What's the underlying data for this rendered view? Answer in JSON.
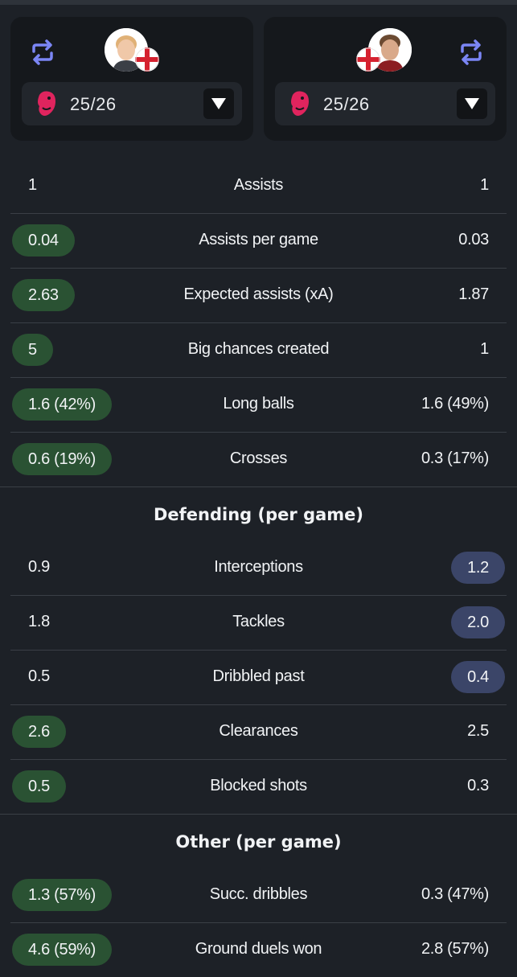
{
  "players": [
    {
      "season": "25/26",
      "competition_icon": "premier-league-icon",
      "swap_icon": "swap-icon",
      "flag_icon": "england-flag-icon"
    },
    {
      "season": "25/26",
      "competition_icon": "premier-league-icon",
      "swap_icon": "swap-icon",
      "flag_icon": "england-flag-icon"
    }
  ],
  "colors": {
    "left_highlight": "#2a5233",
    "right_highlight": "#3b4568",
    "background": "#1d2127",
    "card": "#15181c"
  },
  "sections": [
    {
      "title": "",
      "rows": [
        {
          "label": "Assists",
          "left": "1",
          "right": "1",
          "winner": "none"
        },
        {
          "label": "Assists per game",
          "left": "0.04",
          "right": "0.03",
          "winner": "left"
        },
        {
          "label": "Expected assists (xA)",
          "left": "2.63",
          "right": "1.87",
          "winner": "left"
        },
        {
          "label": "Big chances created",
          "left": "5",
          "right": "1",
          "winner": "left"
        },
        {
          "label": "Long balls",
          "left": "1.6 (42%)",
          "right": "1.6 (49%)",
          "winner": "left"
        },
        {
          "label": "Crosses",
          "left": "0.6 (19%)",
          "right": "0.3 (17%)",
          "winner": "left"
        }
      ]
    },
    {
      "title": "Defending (per game)",
      "rows": [
        {
          "label": "Interceptions",
          "left": "0.9",
          "right": "1.2",
          "winner": "right"
        },
        {
          "label": "Tackles",
          "left": "1.8",
          "right": "2.0",
          "winner": "right"
        },
        {
          "label": "Dribbled past",
          "left": "0.5",
          "right": "0.4",
          "winner": "right"
        },
        {
          "label": "Clearances",
          "left": "2.6",
          "right": "2.5",
          "winner": "left"
        },
        {
          "label": "Blocked shots",
          "left": "0.5",
          "right": "0.3",
          "winner": "left"
        }
      ]
    },
    {
      "title": "Other (per game)",
      "rows": [
        {
          "label": "Succ. dribbles",
          "left": "1.3 (57%)",
          "right": "0.3 (47%)",
          "winner": "left"
        },
        {
          "label": "Ground duels won",
          "left": "4.6 (59%)",
          "right": "2.8 (57%)",
          "winner": "left"
        }
      ]
    }
  ]
}
